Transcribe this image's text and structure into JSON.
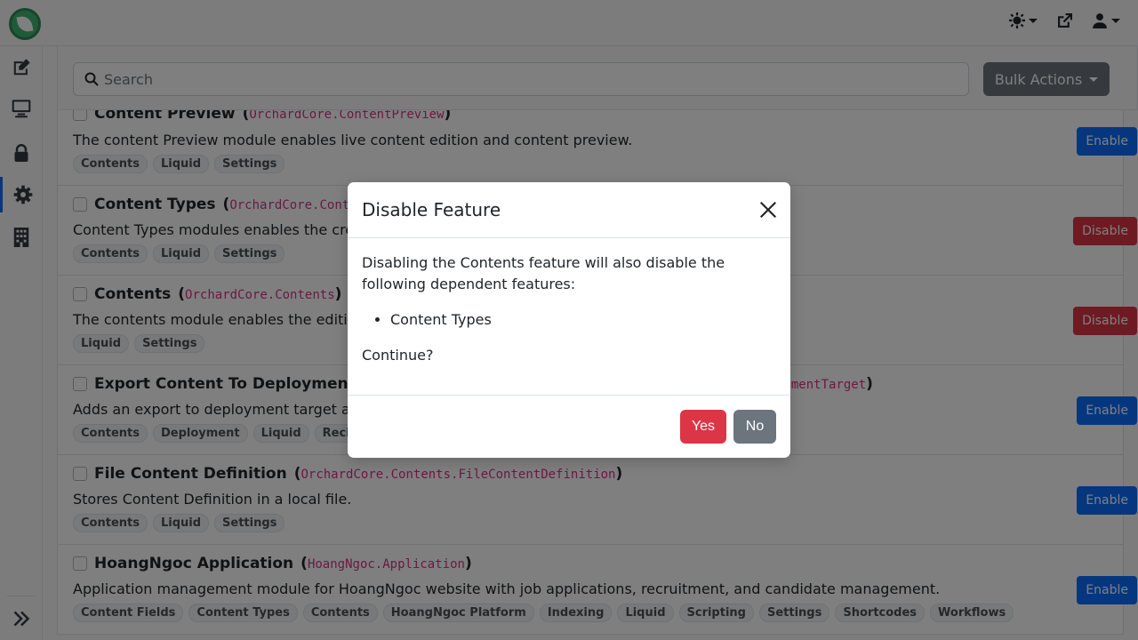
{
  "top_icons": [
    {
      "name": "theme-toggle",
      "icon": "sun-gear"
    },
    {
      "name": "visit-site",
      "icon": "external-link"
    },
    {
      "name": "user-menu",
      "icon": "user"
    }
  ],
  "sidebar": {
    "items": [
      {
        "name": "content",
        "icon": "edit-icon"
      },
      {
        "name": "design",
        "icon": "desktop-icon"
      },
      {
        "name": "security",
        "icon": "lock-icon"
      },
      {
        "name": "configuration",
        "icon": "gear-icon",
        "active": true
      },
      {
        "name": "tenants",
        "icon": "building-icon"
      }
    ]
  },
  "filter": {
    "search_placeholder": "Search",
    "bulk_label": "Bulk Actions"
  },
  "features": [
    {
      "title": "Content Preview",
      "id": "OrchardCore.ContentPreview",
      "description": "The content Preview module enables live content edition and content preview.",
      "tags": [
        "Contents",
        "Liquid",
        "Settings"
      ],
      "action": "Enable"
    },
    {
      "title": "Content Types",
      "id": "OrchardCore.Conter",
      "description": "Content Types modules enables the cre",
      "tags": [
        "Contents",
        "Liquid",
        "Settings"
      ],
      "action": "Disable"
    },
    {
      "title": "Contents",
      "id": "OrchardCore.Contents",
      "description": "The contents module enables the editi",
      "tags": [
        "Liquid",
        "Settings"
      ],
      "action": "Disable"
    },
    {
      "title": "Export Content To Deployment T",
      "id": "",
      "description": "Adds an export to deployment target a",
      "tags": [
        "Contents",
        "Deployment",
        "Liquid",
        "Recipes"
      ],
      "action": "Enable"
    },
    {
      "title": "File Content Definition",
      "id": "OrchardCore.Contents.FileContentDefinition",
      "description": "Stores Content Definition in a local file.",
      "tags": [
        "Contents",
        "Liquid",
        "Settings"
      ],
      "action": "Enable"
    },
    {
      "title": "HoangNgoc Application",
      "id": "HoangNgoc.Application",
      "description": "Application management module for HoangNgoc website with job applications, recruitment, and candidate management.",
      "tags": [
        "Content Fields",
        "Content Types",
        "Contents",
        "HoangNgoc Platform",
        "Indexing",
        "Liquid",
        "Scripting",
        "Settings",
        "Shortcodes",
        "Workflows"
      ],
      "action": "Enable"
    }
  ],
  "partial_text": {
    "export_tail": "oymentTarget",
    "export_close": ")"
  },
  "modal": {
    "title": "Disable Feature",
    "message": "Disabling the Contents feature will also disable the following dependent features:",
    "dependents": [
      "Content Types"
    ],
    "question": "Continue?",
    "yes_label": "Yes",
    "no_label": "No"
  },
  "colors": {
    "primary": "#0d6efd",
    "danger": "#dc3545",
    "secondary": "#6c757d",
    "code": "#d63384"
  }
}
